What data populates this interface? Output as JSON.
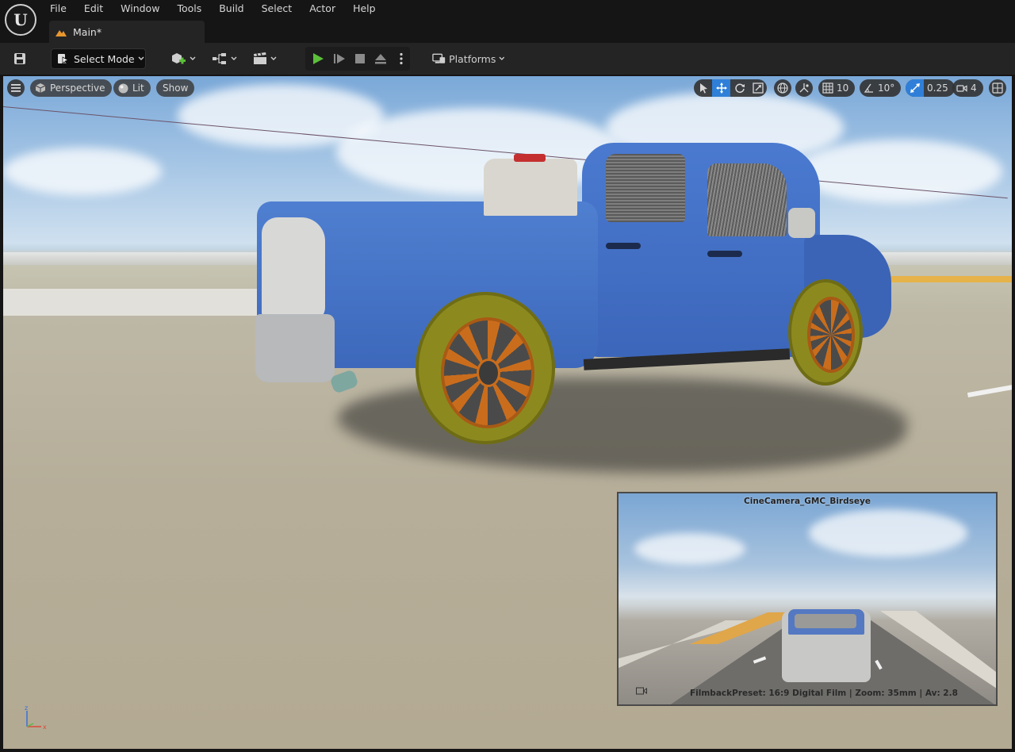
{
  "menu": [
    "File",
    "Edit",
    "Window",
    "Tools",
    "Build",
    "Select",
    "Actor",
    "Help"
  ],
  "document_tab": {
    "label": "Main*"
  },
  "toolbar": {
    "mode_label": "Select Mode",
    "platforms_label": "Platforms"
  },
  "viewport": {
    "perspective_label": "Perspective",
    "lit_label": "Lit",
    "show_label": "Show",
    "grid_snap": "10",
    "rotation_snap": "10°",
    "scale_snap": "0.25",
    "camera_speed": "4"
  },
  "camera_preview": {
    "title": "CineCamera_GMC_Birdseye",
    "caption": "FilmbackPreset: 16:9 Digital Film | Zoom: 35mm | Av: 2.8"
  },
  "colors": {
    "accent": "#2f7fd8",
    "play_green": "#5bbf3a",
    "truck_blue": "#4a78cc"
  }
}
